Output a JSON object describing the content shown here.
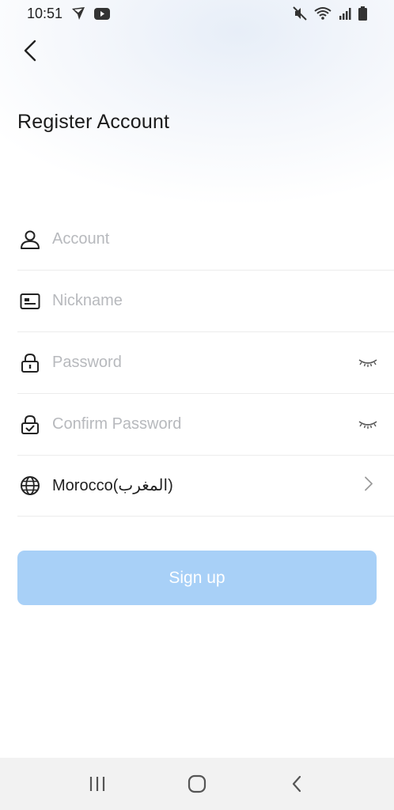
{
  "status_bar": {
    "time": "10:51",
    "icons_left": [
      "location-arrow-icon",
      "youtube-icon"
    ],
    "icons_right": [
      "mute-icon",
      "wifi-icon",
      "signal-icon",
      "battery-icon"
    ]
  },
  "header": {
    "title": "Register Account",
    "back_icon": "chevron-left-icon"
  },
  "form": {
    "account": {
      "placeholder": "Account",
      "value": "",
      "icon": "user-icon"
    },
    "nickname": {
      "placeholder": "Nickname",
      "value": "",
      "icon": "id-card-icon"
    },
    "password": {
      "placeholder": "Password",
      "value": "",
      "icon": "lock-icon",
      "toggle_icon": "eye-closed-icon"
    },
    "confirm_password": {
      "placeholder": "Confirm Password",
      "value": "",
      "icon": "lock-check-icon",
      "toggle_icon": "eye-closed-icon"
    },
    "country": {
      "label": "Morocco(المغرب)",
      "icon": "globe-icon",
      "chevron_icon": "chevron-right-icon"
    }
  },
  "signup_button": {
    "label": "Sign up"
  },
  "colors": {
    "button_bg": "#a8d0f7",
    "placeholder": "#b7b9bd",
    "divider": "#ececec"
  },
  "nav_bar": {
    "icons": [
      "recent-apps-icon",
      "home-icon",
      "back-icon"
    ]
  }
}
